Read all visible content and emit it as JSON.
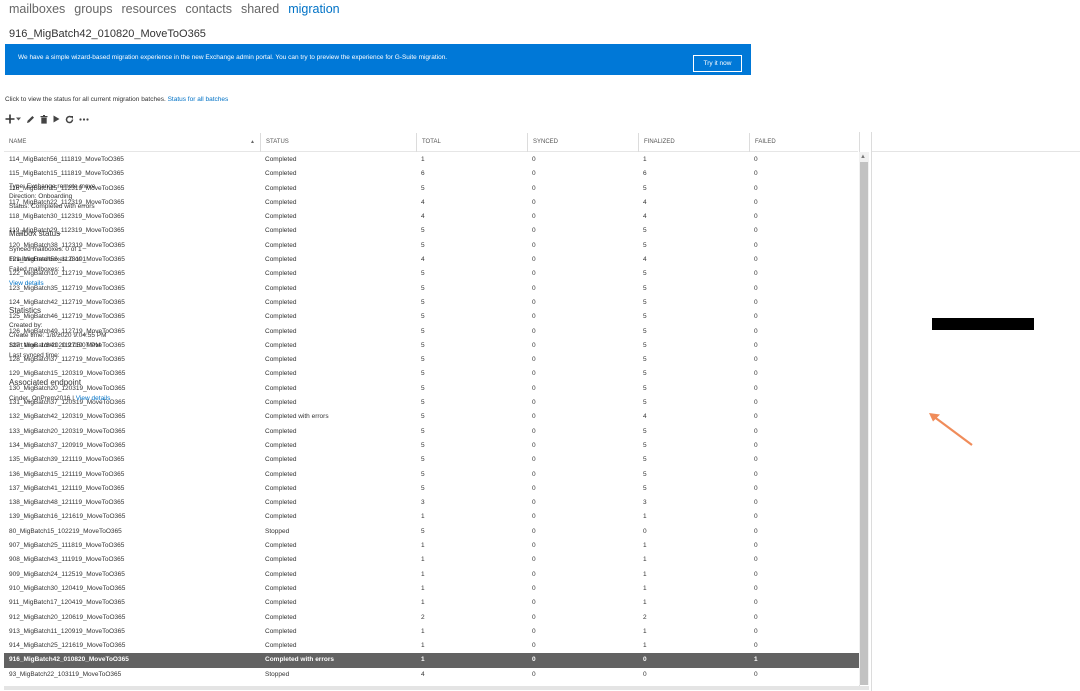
{
  "nav": {
    "items": [
      "mailboxes",
      "groups",
      "resources",
      "contacts",
      "shared",
      "migration"
    ],
    "active": "migration"
  },
  "banner": {
    "text": "We have a simple wizard-based migration experience in the new Exchange admin portal. You can try to preview the experience for G-Suite migration.",
    "button": "Try it now",
    "color": "#0078d7"
  },
  "status_line": {
    "text": "Click to view the status for all current migration batches.",
    "link": "Status for all batches"
  },
  "toolbar": {
    "icons": [
      "add-icon",
      "chevron-down-icon",
      "edit-icon",
      "delete-icon",
      "play-icon",
      "refresh-icon",
      "more-icon"
    ]
  },
  "table": {
    "columns": [
      "NAME",
      "STATUS",
      "TOTAL",
      "SYNCED",
      "FINALIZED",
      "FAILED"
    ],
    "selected_index": 35,
    "rows": [
      [
        "114_MigBatch56_111819_MoveToO365",
        "Completed",
        "1",
        "0",
        "1",
        "0"
      ],
      [
        "115_MigBatch15_111819_MoveToO365",
        "Completed",
        "6",
        "0",
        "6",
        "0"
      ],
      [
        "116_MigBatch15_112319_MoveToO365",
        "Completed",
        "5",
        "0",
        "5",
        "0"
      ],
      [
        "117_MigBatch22_112319_MoveToO365",
        "Completed",
        "4",
        "0",
        "4",
        "0"
      ],
      [
        "118_MigBatch30_112319_MoveToO365",
        "Completed",
        "4",
        "0",
        "4",
        "0"
      ],
      [
        "119_MigBatch29_112319_MoveToO365",
        "Completed",
        "5",
        "0",
        "5",
        "0"
      ],
      [
        "120_MigBatch38_112319_MoveToO365",
        "Completed",
        "5",
        "0",
        "5",
        "0"
      ],
      [
        "121_MigBatch56_112319_MoveToO365",
        "Completed",
        "4",
        "0",
        "4",
        "0"
      ],
      [
        "122_MigBatch10_112719_MoveToO365",
        "Completed",
        "5",
        "0",
        "5",
        "0"
      ],
      [
        "123_MigBatch35_112719_MoveToO365",
        "Completed",
        "5",
        "0",
        "5",
        "0"
      ],
      [
        "124_MigBatch42_112719_MoveToO365",
        "Completed",
        "5",
        "0",
        "5",
        "0"
      ],
      [
        "125_MigBatch46_112719_MoveToO365",
        "Completed",
        "5",
        "0",
        "5",
        "0"
      ],
      [
        "126_MigBatch49_112719_MoveToO365",
        "Completed",
        "5",
        "0",
        "5",
        "0"
      ],
      [
        "127_MigBatch41_112719_MoveToO365",
        "Completed",
        "5",
        "0",
        "5",
        "0"
      ],
      [
        "128_MigBatch37_112719_MoveToO365",
        "Completed",
        "5",
        "0",
        "5",
        "0"
      ],
      [
        "129_MigBatch15_120319_MoveToO365",
        "Completed",
        "5",
        "0",
        "5",
        "0"
      ],
      [
        "130_MigBatch20_120319_MoveToO365",
        "Completed",
        "5",
        "0",
        "5",
        "0"
      ],
      [
        "131_MigBatch37_120319_MoveToO365",
        "Completed",
        "5",
        "0",
        "5",
        "0"
      ],
      [
        "132_MigBatch42_120319_MoveToO365",
        "Completed with errors",
        "5",
        "0",
        "4",
        "0"
      ],
      [
        "133_MigBatch20_120319_MoveToO365",
        "Completed",
        "5",
        "0",
        "5",
        "0"
      ],
      [
        "134_MigBatch37_120919_MoveToO365",
        "Completed",
        "5",
        "0",
        "5",
        "0"
      ],
      [
        "135_MigBatch39_121119_MoveToO365",
        "Completed",
        "5",
        "0",
        "5",
        "0"
      ],
      [
        "136_MigBatch15_121119_MoveToO365",
        "Completed",
        "5",
        "0",
        "5",
        "0"
      ],
      [
        "137_MigBatch41_121119_MoveToO365",
        "Completed",
        "5",
        "0",
        "5",
        "0"
      ],
      [
        "138_MigBatch48_121119_MoveToO365",
        "Completed",
        "3",
        "0",
        "3",
        "0"
      ],
      [
        "139_MigBatch16_121619_MoveToO365",
        "Completed",
        "1",
        "0",
        "1",
        "0"
      ],
      [
        "80_MigBatch15_102219_MoveToO365",
        "Stopped",
        "5",
        "0",
        "0",
        "0"
      ],
      [
        "907_MigBatch25_111819_MoveToO365",
        "Completed",
        "1",
        "0",
        "1",
        "0"
      ],
      [
        "908_MigBatch43_111919_MoveToO365",
        "Completed",
        "1",
        "0",
        "1",
        "0"
      ],
      [
        "909_MigBatch24_112519_MoveToO365",
        "Completed",
        "1",
        "0",
        "1",
        "0"
      ],
      [
        "910_MigBatch30_120419_MoveToO365",
        "Completed",
        "1",
        "0",
        "1",
        "0"
      ],
      [
        "911_MigBatch17_120419_MoveToO365",
        "Completed",
        "1",
        "0",
        "1",
        "0"
      ],
      [
        "912_MigBatch20_120619_MoveToO365",
        "Completed",
        "2",
        "0",
        "2",
        "0"
      ],
      [
        "913_MigBatch11_120919_MoveToO365",
        "Completed",
        "1",
        "0",
        "1",
        "0"
      ],
      [
        "914_MigBatch25_121619_MoveToO365",
        "Completed",
        "1",
        "0",
        "1",
        "0"
      ],
      [
        "916_MigBatch42_010820_MoveToO365",
        "Completed with errors",
        "1",
        "0",
        "0",
        "1"
      ],
      [
        "93_MigBatch22_103119_MoveToO365",
        "Stopped",
        "4",
        "0",
        "0",
        "0"
      ]
    ]
  },
  "details": {
    "title": "916_MigBatch42_010820_MoveToO365",
    "type": "Type: Exchange remote move",
    "direction": "Direction: Onboarding",
    "status": "Status: Completed with errors",
    "mailbox_status_heading": "Mailbox status",
    "synced": "Synced mailboxes: 0 of 1",
    "finalized": "Finalized mailboxes: 0 of 1",
    "failed": "Failed mailboxes: 1",
    "view_details": "View details",
    "statistics_heading": "Statistics",
    "created_by": "Created by:",
    "create_time": "Create time: 1/8/2020 9:04:55 PM",
    "start_time": "Start time: 1/8/2020 9:05:07 PM",
    "last_synced": "Last synced time:",
    "endpoint_heading": "Associated endpoint",
    "endpoint_name": "Cinder_OnPrem2016",
    "endpoint_sep": " | ",
    "endpoint_link": "View details",
    "arrow_color": "#f08c5a"
  }
}
